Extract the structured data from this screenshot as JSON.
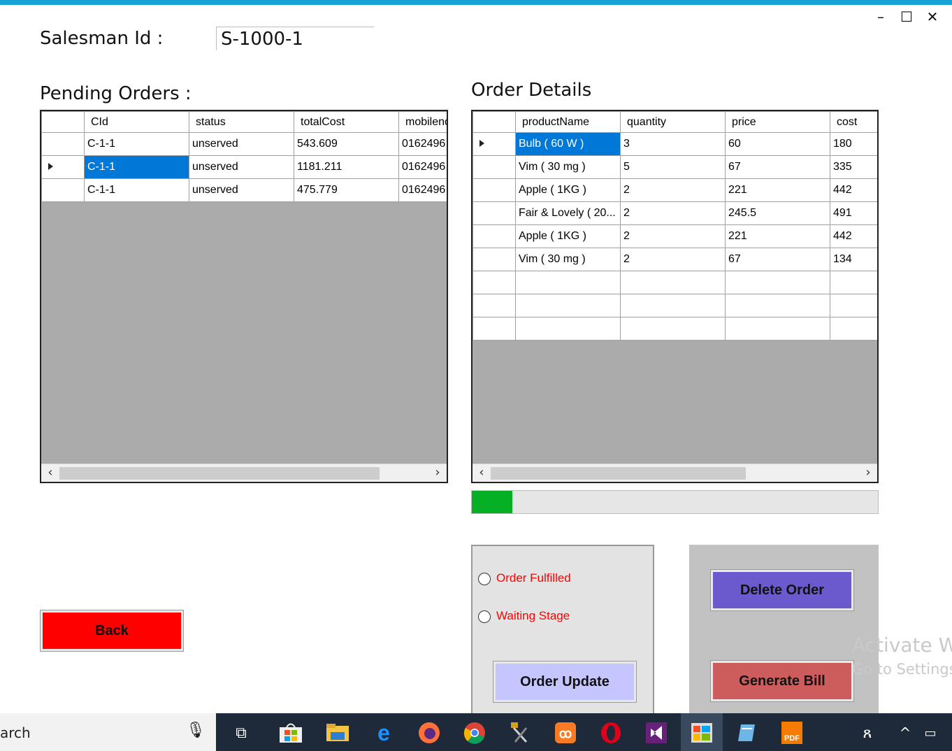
{
  "window": {
    "minimize": "–",
    "maximize": "☐",
    "close": "✕"
  },
  "salesman": {
    "label": "Salesman Id :",
    "value": "S-1000-1"
  },
  "pending": {
    "title": "Pending Orders :",
    "columns": [
      "CId",
      "status",
      "totalCost",
      "mobileno"
    ],
    "rows": [
      {
        "cid": "C-1-1",
        "status": "unserved",
        "total": "543.609",
        "mobile": "0162496"
      },
      {
        "cid": "C-1-1",
        "status": "unserved",
        "total": "1181.211",
        "mobile": "0162496"
      },
      {
        "cid": "C-1-1",
        "status": "unserved",
        "total": "475.779",
        "mobile": "0162496"
      }
    ]
  },
  "details": {
    "title": "Order Details",
    "columns": [
      "productName",
      "quantity",
      "price",
      "cost"
    ],
    "rows": [
      {
        "name": "Bulb ( 60 W )",
        "qty": "3",
        "price": "60",
        "cost": "180"
      },
      {
        "name": "Vim ( 30 mg )",
        "qty": "5",
        "price": "67",
        "cost": "335"
      },
      {
        "name": "Apple ( 1KG )",
        "qty": "2",
        "price": "221",
        "cost": "442"
      },
      {
        "name": "Fair & Lovely ( 20...",
        "qty": "2",
        "price": "245.5",
        "cost": "491"
      },
      {
        "name": "Apple ( 1KG )",
        "qty": "2",
        "price": "221",
        "cost": "442"
      },
      {
        "name": "Vim ( 30 mg )",
        "qty": "2",
        "price": "67",
        "cost": "134"
      }
    ]
  },
  "progress": {
    "value_percent": 10
  },
  "status_group": {
    "option1": "Order Fulfilled",
    "option2": "Waiting Stage"
  },
  "buttons": {
    "back": "Back",
    "order_update": "Order Update",
    "delete_order": "Delete Order",
    "generate_bill": "Generate Bill"
  },
  "watermark": {
    "line1": "Activate W",
    "line2": "Go to Settings"
  },
  "taskbar": {
    "search_text": "arch"
  },
  "colors": {
    "accent": "#17a2d7",
    "back_btn": "#ff0000",
    "update_btn": "#c5c5ff",
    "delete_btn": "#6a5acd",
    "bill_btn": "#cd5c5c",
    "selection": "#0078d7",
    "progress": "#06b025"
  }
}
